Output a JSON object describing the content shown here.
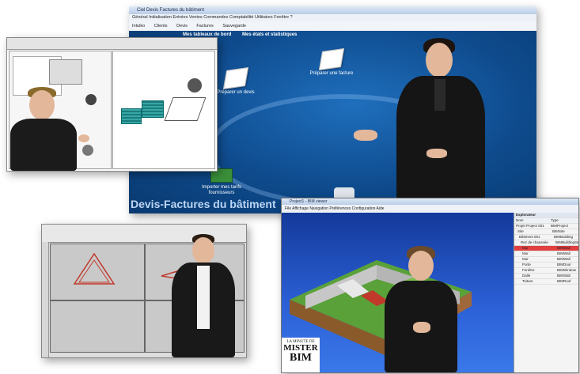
{
  "main_window": {
    "title": "Ciel Devis Factures du bâtiment",
    "menu": "Général  Initialisation  Entrées  Ventes  Commandes  Comptabilité  Utilitaires  Fenêtre  ?",
    "toolbar": [
      "Intuiko",
      "Clients",
      "Devis",
      "Factures",
      "Sauvegarde"
    ],
    "tabs": [
      "Mes tableaux de bord",
      "Mes états et statistiques"
    ],
    "tiles": [
      {
        "label": "Préparer un devis"
      },
      {
        "label": "Préparer une facture"
      },
      {
        "label": "Importer mes tarifs fournisseurs"
      }
    ],
    "footer_text": "Devis-Factures du bâtiment"
  },
  "bim_window": {
    "title": "Project1 - BIM viewer",
    "menu": "File  Affichage  Navigation  Préférences  Configuration  Aide",
    "panel_title": "Explorateur",
    "panel_header": [
      "Nom",
      "Type"
    ],
    "rows": [
      [
        "Projet Project 001",
        "BIMProject"
      ],
      [
        "Site",
        "BIMSite"
      ],
      [
        "Bâtiment 001",
        "BIMBuilding"
      ],
      [
        "Rez de chaussée",
        "BIMBuildingStorey"
      ],
      [
        "Mur",
        "BIMWall"
      ],
      [
        "Mur",
        "BIMWall"
      ],
      [
        "Mur",
        "BIMWall"
      ],
      [
        "Porte",
        "BIMDoor"
      ],
      [
        "Fenêtre",
        "BIMWindow"
      ],
      [
        "Dalle",
        "BIMSlab"
      ],
      [
        "Toiture",
        "BIMRoof"
      ]
    ],
    "logo_line1": "LA MINUTE DE",
    "logo_line2": "MISTER",
    "logo_line3": "BIM"
  },
  "colors": {
    "main_bg": "#0f4f95",
    "bim_sky": "#2c61d8",
    "cad_accent": "#1b7c7c"
  }
}
